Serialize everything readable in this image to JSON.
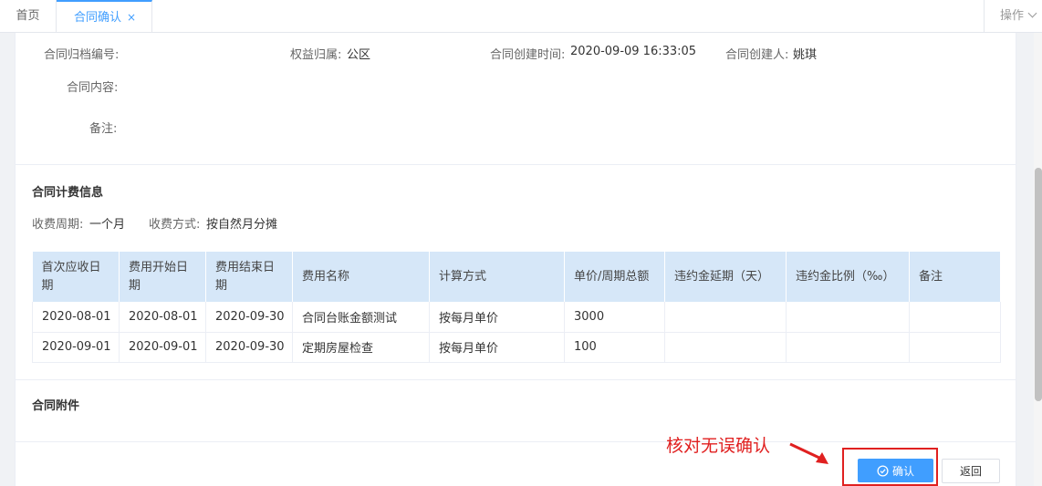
{
  "tabs": {
    "home": "首页",
    "active": "合同确认",
    "close": "×",
    "ops": "操作"
  },
  "contract": {
    "archive_no_label": "合同归档编号:",
    "archive_no_value": "",
    "rights_label": "权益归属:",
    "rights_value": "公区",
    "created_time_label": "合同创建时间:",
    "created_time_value": "2020-09-09 16:33:05",
    "creator_label": "合同创建人:",
    "creator_value": "姚琪",
    "content_label": "合同内容:",
    "remark_label": "备注:"
  },
  "billing": {
    "title": "合同计费信息",
    "cycle_label": "收费周期:",
    "cycle_value": "一个月",
    "method_label": "收费方式:",
    "method_value": "按自然月分摊",
    "columns": [
      "首次应收日期",
      "费用开始日期",
      "费用结束日期",
      "费用名称",
      "计算方式",
      "单价/周期总额",
      "违约金延期（天）",
      "违约金比例（‰）",
      "备注"
    ],
    "rows": [
      [
        "2020-08-01",
        "2020-08-01",
        "2020-09-30",
        "合同台账金额测试",
        "按每月单价",
        "3000",
        "",
        "",
        ""
      ],
      [
        "2020-09-01",
        "2020-09-01",
        "2020-09-30",
        "定期房屋检查",
        "按每月单价",
        "100",
        "",
        "",
        ""
      ]
    ]
  },
  "attachments": {
    "title": "合同附件"
  },
  "footer": {
    "confirm_label": "确认",
    "back_label": "返回",
    "annotation": "核对无误确认"
  },
  "icons": {
    "confirm": "check-circle-icon",
    "arrow": "red-arrow-icon",
    "tab_close": "close-icon",
    "ops_chevron": "chevron-down-icon"
  },
  "colors": {
    "primary": "#409eff",
    "header_bg": "#d6e7f8",
    "annotation": "#e02020"
  }
}
